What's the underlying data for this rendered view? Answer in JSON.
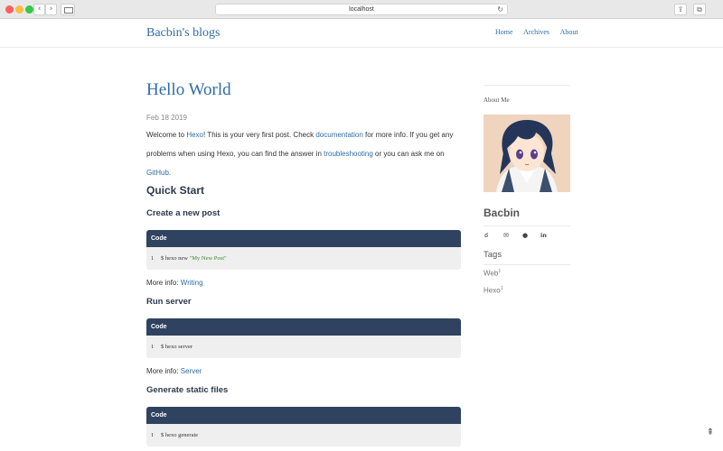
{
  "browser": {
    "url": "localhost",
    "back_icon": "‹",
    "forward_icon": "›",
    "reload_icon": "↻",
    "share_icon": "⇪",
    "tabs_icon": "⧉"
  },
  "site": {
    "title": "Bacbin's blogs",
    "nav": [
      "Home",
      "Archives",
      "About"
    ]
  },
  "post": {
    "title": "Hello World",
    "date": "Feb 18 2019",
    "intro": {
      "t1": "Welcome to ",
      "link_hexo": "Hexo",
      "t2": "! This is your very first post. Check ",
      "link_docs": "documentation",
      "t3": " for more info. If you get any problems when using Hexo, you can find the answer in ",
      "link_troubleshooting": "troubleshooting",
      "t4": " or you can ask me on ",
      "link_github": "GitHub",
      "t5": "."
    },
    "quick_start_heading": "Quick Start",
    "sections": [
      {
        "heading": "Create a new post",
        "code_label": "Code",
        "line_no": "1",
        "command": "$ hexo new ",
        "command_arg": "\"My New Post\"",
        "more_label": "More info: ",
        "more_link": "Writing"
      },
      {
        "heading": "Run server",
        "code_label": "Code",
        "line_no": "1",
        "command": "$ hexo server",
        "more_label": "More info: ",
        "more_link": "Server"
      },
      {
        "heading": "Generate static files",
        "code_label": "Code",
        "line_no": "1",
        "command": "$ hexo generate"
      }
    ]
  },
  "sidebar": {
    "about_title": "About Me",
    "author": "Bacbin",
    "social_icons": [
      "weibo-icon",
      "mail-icon",
      "github-icon",
      "linkedin-icon"
    ],
    "social_glyphs": [
      "ఠ",
      "✉",
      "●",
      "in"
    ],
    "tags_title": "Tags",
    "tags": [
      {
        "name": "Web",
        "count": "1"
      },
      {
        "name": "Hexo",
        "count": "1"
      }
    ]
  },
  "scroll_top_icon": "⇞",
  "colors": {
    "link": "#2e6da4",
    "code_header": "#2f4360",
    "code_bg": "#efefef",
    "string": "#3a8a28"
  }
}
